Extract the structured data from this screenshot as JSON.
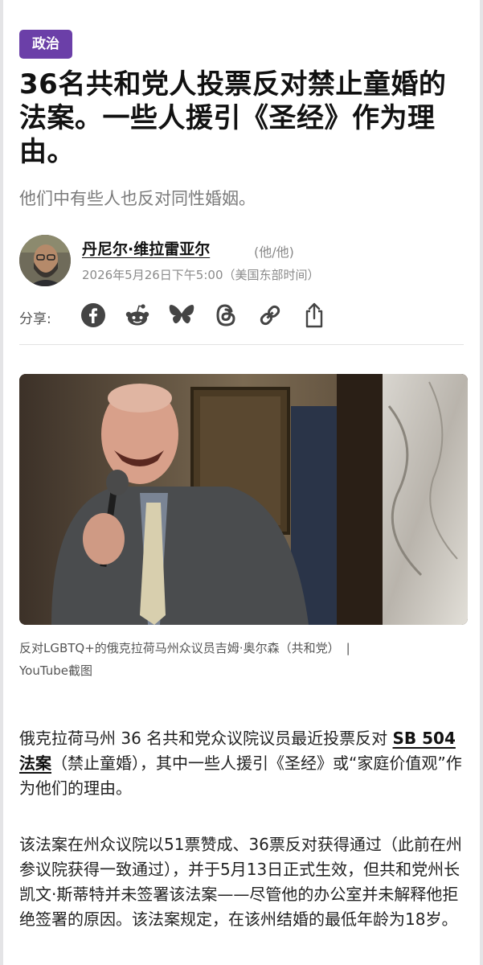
{
  "article": {
    "category": "政治",
    "headline": "36名共和党人投票反对禁止童婚的法案。一些人援引《圣经》作为理由。",
    "subheadline": "他们中有些人也反对同性婚姻。"
  },
  "byline": {
    "author": "丹尼尔·维拉雷亚尔",
    "pronouns": "(他/他)",
    "timestamp": "2026年5月26日下午5:00（美国东部时间）"
  },
  "share": {
    "label": "分享:",
    "icons": [
      "facebook-icon",
      "reddit-icon",
      "bluesky-icon",
      "threads-icon",
      "link-icon",
      "share-icon"
    ]
  },
  "photo": {
    "caption": "反对LGBTQ+的俄克拉荷马州众议员吉姆·奥尔森（共和党）",
    "separator": "|",
    "credit": "YouTube截图"
  },
  "body": {
    "p1_before": "俄克拉荷马州 36 名共和党众议院议员最近投票反对 ",
    "p1_link": "SB 504 法案",
    "p1_after": "（禁止童婚），其中一些人援引《圣经》或“家庭价值观”作为他们的理由。",
    "p2": "该法案在州众议院以51票赞成、36票反对获得通过（此前在州参议院获得一致通过），并于5月13日正式生效，但共和党州长凯文·斯蒂特并未签署该法案——尽管他的办公室并未解释他拒绝签署的原因。该法案规定，在该州结婚的最低年龄为18岁。"
  },
  "colors": {
    "category_badge": "#6b3fa8",
    "text": "#1a1a1a",
    "muted": "#7a7a7a"
  }
}
